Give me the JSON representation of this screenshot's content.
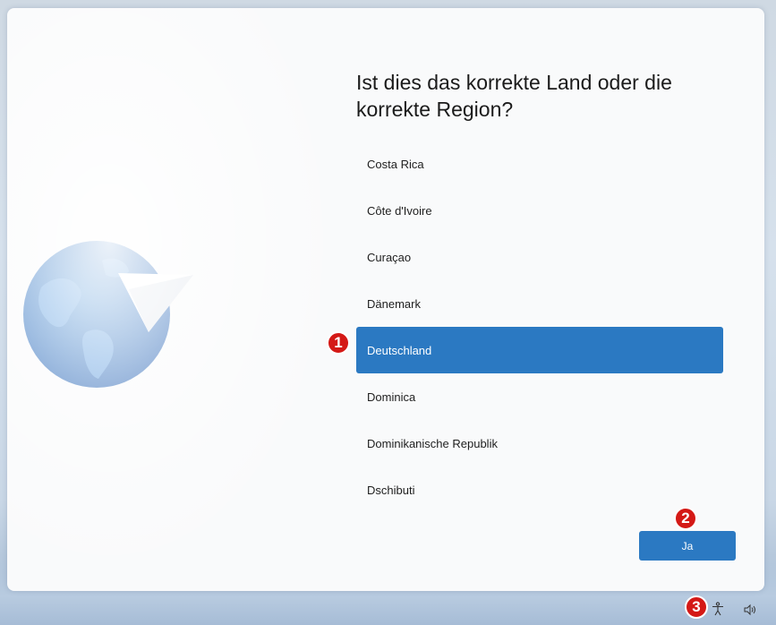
{
  "screen": {
    "title": "Ist dies das korrekte Land oder die korrekte Region?",
    "countries": [
      "Costa Rica",
      "Côte d'Ivoire",
      "Curaçao",
      "Dänemark",
      "Deutschland",
      "Dominica",
      "Dominikanische Republik",
      "Dschibuti"
    ],
    "selected_country": "Deutschland",
    "confirm_button": "Ja"
  },
  "annotations": [
    "1",
    "2",
    "3"
  ],
  "taskbar": {
    "icons": [
      "accessibility-icon",
      "volume-icon"
    ]
  },
  "colors": {
    "accent": "#2b79c2",
    "badge": "#d41916"
  }
}
